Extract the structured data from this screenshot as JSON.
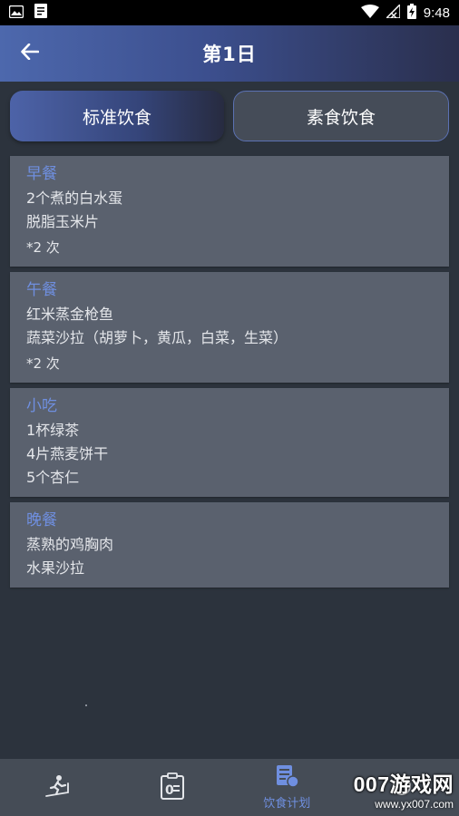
{
  "status_bar": {
    "time": "9:48",
    "icons": [
      "image-icon",
      "doc-icon",
      "wifi-icon",
      "signal-icon",
      "battery-charging-icon"
    ]
  },
  "header": {
    "title": "第1日",
    "back_icon": "arrow-left-icon"
  },
  "tabs": [
    {
      "label": "标准饮食",
      "active": true
    },
    {
      "label": "素食饮食",
      "active": false
    }
  ],
  "meals": [
    {
      "title": "早餐",
      "items": [
        "2个煮的白水蛋",
        "脱脂玉米片"
      ],
      "repeat": "*2 次"
    },
    {
      "title": "午餐",
      "items": [
        "红米蒸金枪鱼",
        "蔬菜沙拉（胡萝卜，黄瓜，白菜，生菜）"
      ],
      "repeat": "*2 次"
    },
    {
      "title": "小吃",
      "items": [
        "1杯绿茶",
        "4片燕麦饼干",
        "5个杏仁"
      ]
    },
    {
      "title": "晚餐",
      "items": [
        "蒸熟的鸡胸肉",
        "水果沙拉"
      ]
    }
  ],
  "bottom_nav": [
    {
      "icon": "treadmill-icon",
      "label": ""
    },
    {
      "icon": "clipboard-icon",
      "label": ""
    },
    {
      "icon": "diet-plan-icon",
      "label": "饮食计划",
      "active": true
    },
    {
      "icon": "more-icon",
      "label": ""
    }
  ],
  "watermark": {
    "main": "007游戏网",
    "url": "www.yx007.com"
  },
  "colors": {
    "accent": "#6f8fe0",
    "background": "#2c333d",
    "card": "#5a616e",
    "nav": "#454c56"
  }
}
